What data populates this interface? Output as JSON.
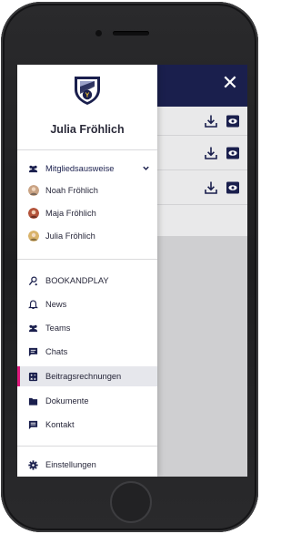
{
  "header": {
    "close_label": "✕"
  },
  "drawer": {
    "user_name": "Julia Fröhlich",
    "membership": {
      "label": "Mitgliedsausweise",
      "members": [
        {
          "name": "Noah Fröhlich",
          "avatar_color": "#c9a384"
        },
        {
          "name": "Maja Fröhlich",
          "avatar_color": "#b3533a"
        },
        {
          "name": "Julia Fröhlich",
          "avatar_color": "#d9b36a"
        }
      ]
    },
    "menu": [
      {
        "label": "BOOKANDPLAY",
        "icon": "bookandplay-icon"
      },
      {
        "label": "News",
        "icon": "bell-icon"
      },
      {
        "label": "Teams",
        "icon": "team-icon"
      },
      {
        "label": "Chats",
        "icon": "chat-icon"
      },
      {
        "label": "Beitragsrechnungen",
        "icon": "invoice-icon",
        "active": true
      },
      {
        "label": "Dokumente",
        "icon": "folder-icon"
      },
      {
        "label": "Kontakt",
        "icon": "contact-icon"
      }
    ],
    "settings_label": "Einstellungen"
  },
  "colors": {
    "header_bg": "#1a1f4d",
    "active_accent": "#e0197d",
    "active_bg": "#e6e7ec",
    "icon_dark": "#1a1f4d"
  }
}
